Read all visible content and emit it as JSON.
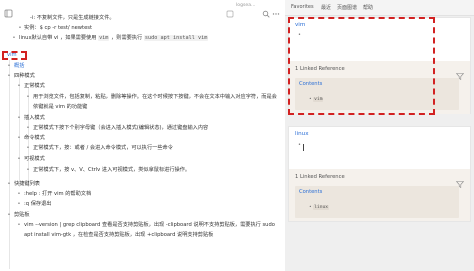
{
  "left": {
    "toolbar": {
      "page_title": "logsea...",
      "icons": [
        "tree-icon",
        "page-icon",
        "search-icon",
        "lightning-icon",
        "more-icon",
        "settings-icon"
      ]
    },
    "lines": [
      {
        "bullet": "-",
        "text": "-i: 不复制文件，只是生成链接文件。"
      },
      {
        "bullet": "•",
        "text": "实例：$ cp -r test/ newtest"
      },
      {
        "bullet": "•",
        "pre": "linux默认自带 vi ，如果需要使用 ",
        "code1": "vim",
        "mid": " ，则需要执行 ",
        "code2": "sudo apt install vim"
      },
      {
        "bullet": "",
        "text": "vim",
        "link": true
      },
      {
        "bullet": "•",
        "text": "概括",
        "link": true
      },
      {
        "bullet": "•",
        "text": "四种模式"
      },
      {
        "bullet": "•",
        "text": "正常模式"
      },
      {
        "bullet": "•",
        "text": "用于浏览文件，包括复制，粘贴，删除等操作。在这个时候按下按键，不会在文本中输入对应字符，而是会依键就是 vim 的功能键"
      },
      {
        "bullet": "•",
        "text": "插入模式"
      },
      {
        "bullet": "•",
        "text": "正常模式下按下个别字母键（会进入插入模式(编辑状态)，通过键盘输入内容"
      },
      {
        "bullet": "•",
        "text": "命令模式"
      },
      {
        "bullet": "•",
        "text": "正常模式下，按：或者 / 会进入命令模式，可以执行一些命令"
      },
      {
        "bullet": "•",
        "text": "可视模式"
      },
      {
        "bullet": "•",
        "text": "正常模式下，按 v、V、Ctrlv 进入可视模式，类似拿鼠标进行操作。"
      },
      {
        "bullet": "•",
        "text": "快捷键列表"
      },
      {
        "bullet": "•",
        "text": ":help : 打开 vim 的帮助文档"
      },
      {
        "bullet": "•",
        "text": ":q 保存退出"
      },
      {
        "bullet": "•",
        "text": "剪贴板"
      },
      {
        "bullet": "•",
        "text": "vim --version | grep clipboard 查看是否支持剪贴板，出现 -clipboard 说明不支持剪贴板，需要执行 sudo apt install vim-gtk ，在检查是否支持剪贴板，出现 +clipboard 说明支持剪贴板"
      }
    ]
  },
  "right": {
    "tabs": [
      "Favorites",
      "最近",
      "页面图谱",
      "帮助"
    ],
    "panels": [
      {
        "title": "vim",
        "bullet": "•",
        "linked_header": "1 Linked Reference",
        "card_title": "Contents",
        "chip": "vim"
      },
      {
        "title": "linux",
        "bullet": "•",
        "linked_header": "1 Linked Reference",
        "card_title": "Contents",
        "chip": "linux"
      }
    ]
  },
  "colors": {
    "link": "#2b6fd6",
    "callout": "#d22222",
    "panel_bg": "#f5f1ec",
    "sidebar_bg": "#efefef"
  }
}
